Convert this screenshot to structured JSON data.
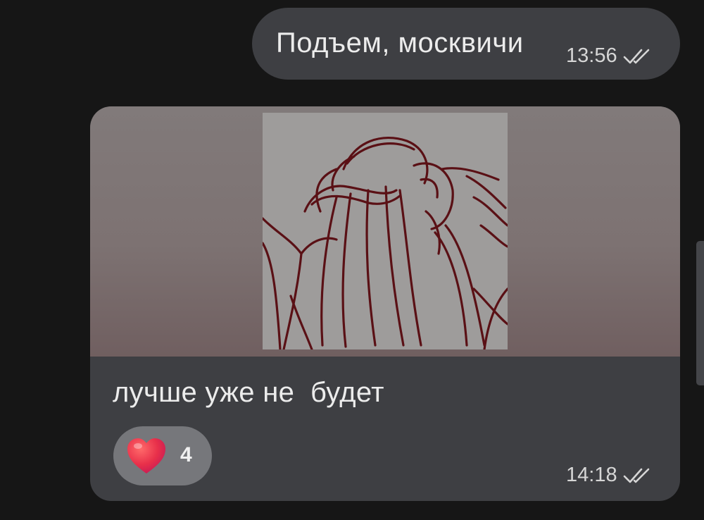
{
  "messages": [
    {
      "text": "Подъем, москвичи",
      "time": "13:56",
      "status_icon": "double-check-icon"
    },
    {
      "media": "sketch-image",
      "caption": "лучше уже не  будет",
      "reaction": {
        "emoji": "heart-icon",
        "count": "4"
      },
      "time": "14:18",
      "status_icon": "double-check-icon"
    }
  ],
  "colors": {
    "background": "#161616",
    "bubble": "#3e3f43",
    "reaction_pill": "#76777b",
    "heart": "#e8304a",
    "sketch_line": "#5a1015"
  }
}
